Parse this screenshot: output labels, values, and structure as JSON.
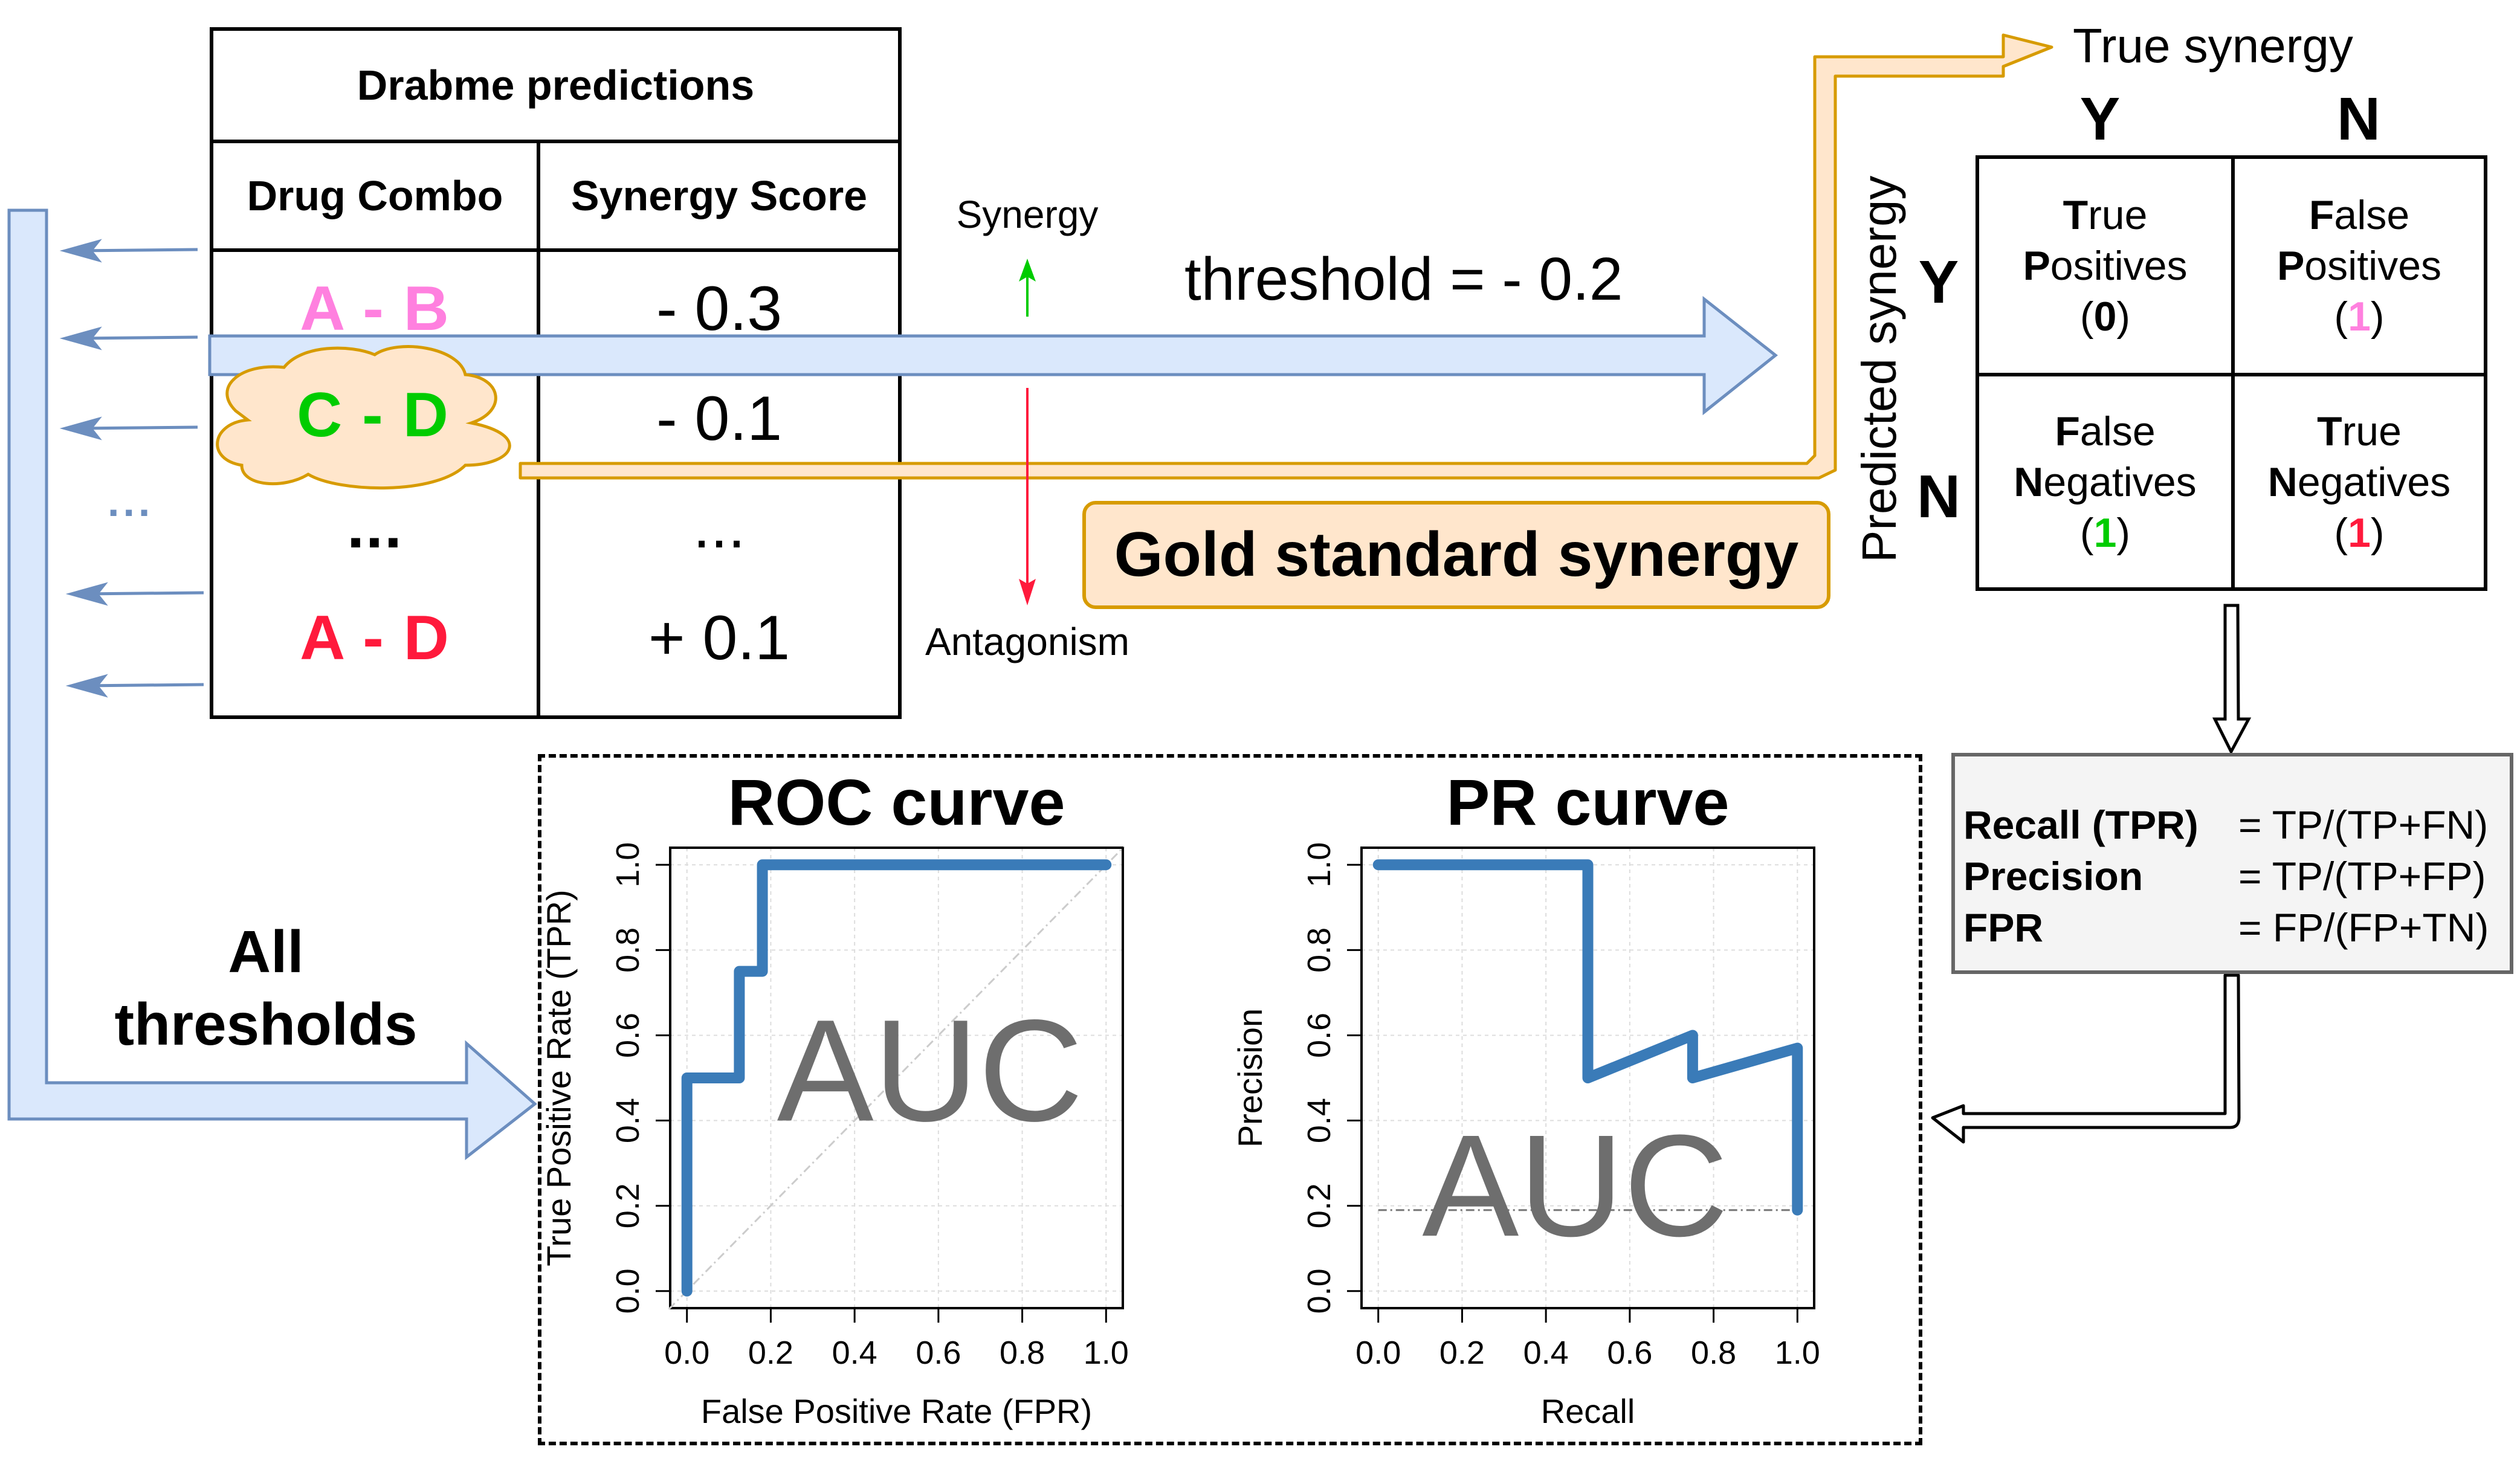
{
  "table": {
    "title": "Drabme predictions",
    "headers": [
      "Drug Combo",
      "Synergy Score"
    ],
    "rows": [
      {
        "combo": "A - B",
        "score": "- 0.3",
        "color": "#ff80df"
      },
      {
        "combo": "C - D",
        "score": "- 0.1",
        "color": "#00cc00"
      },
      {
        "combo": "...",
        "score": "...",
        "color": "#000000"
      },
      {
        "combo": "A - D",
        "score": "+ 0.1",
        "color": "#ff1a3c"
      }
    ],
    "left_ellipsis": "..."
  },
  "direction": {
    "up_label": "Synergy",
    "down_label": "Antagonism"
  },
  "threshold_label": "threshold = - 0.2",
  "gold_standard_label": "Gold standard synergy",
  "all_thresholds_label": [
    "All",
    "thresholds"
  ],
  "confusion_matrix": {
    "true_label": "True synergy",
    "predicted_label": "Predicted synergy",
    "col_labels": [
      "Y",
      "N"
    ],
    "row_labels": [
      "Y",
      "N"
    ],
    "cells": [
      {
        "bold1": "T",
        "rest1": "rue",
        "bold2": "P",
        "rest2": "ositives",
        "count": "0",
        "count_color": "#000000"
      },
      {
        "bold1": "F",
        "rest1": "alse",
        "bold2": "P",
        "rest2": "ositives",
        "count": "1",
        "count_color": "#ff80df"
      },
      {
        "bold1": "F",
        "rest1": "alse",
        "bold2": "N",
        "rest2": "egatives",
        "count": "1",
        "count_color": "#00cc00"
      },
      {
        "bold1": "T",
        "rest1": "rue",
        "bold2": "N",
        "rest2": "egatives",
        "count": "1",
        "count_color": "#ff1a3c"
      }
    ]
  },
  "formulas": [
    {
      "label": "Recall (TPR)",
      "expr": "= TP/(TP+FN)"
    },
    {
      "label": "Precision",
      "expr": "= TP/(TP+FP)"
    },
    {
      "label": "FPR",
      "expr": "= FP/(FP+TN)"
    }
  ],
  "colors": {
    "blue_arrow_fill": "#dae8fc",
    "blue_arrow_stroke": "#6c8ebf",
    "gold_fill": "#ffe6cc",
    "gold_stroke": "#d79b00",
    "curve": "#3a7bb8",
    "auc_text": "#6e6e6e"
  },
  "chart_data": [
    {
      "type": "line",
      "title": "ROC curve",
      "xlabel": "False Positive Rate (FPR)",
      "ylabel": "True Positive Rate (TPR)",
      "xlim": [
        0,
        1
      ],
      "ylim": [
        0,
        1
      ],
      "xticks": [
        "0.0",
        "0.2",
        "0.4",
        "0.6",
        "0.8",
        "1.0"
      ],
      "yticks": [
        "0.0",
        "0.2",
        "0.4",
        "0.6",
        "0.8",
        "1.0"
      ],
      "grid": true,
      "annotation": "AUC",
      "series": [
        {
          "name": "ROC",
          "x": [
            0,
            0,
            0.125,
            0.125,
            0.18,
            0.18,
            1.0
          ],
          "y": [
            0,
            0.5,
            0.5,
            0.75,
            0.75,
            1.0,
            1.0
          ]
        }
      ],
      "reference_line": {
        "x": [
          0,
          1
        ],
        "y": [
          0,
          1
        ],
        "style": "dashed"
      }
    },
    {
      "type": "line",
      "title": "PR curve",
      "xlabel": "Recall",
      "ylabel": "Precision",
      "xlim": [
        0,
        1
      ],
      "ylim": [
        0,
        1
      ],
      "xticks": [
        "0.0",
        "0.2",
        "0.4",
        "0.6",
        "0.8",
        "1.0"
      ],
      "yticks": [
        "0.0",
        "0.2",
        "0.4",
        "0.6",
        "0.8",
        "1.0"
      ],
      "grid": true,
      "annotation": "AUC",
      "series": [
        {
          "name": "PR",
          "x": [
            0,
            0.5,
            0.5,
            0.75,
            0.75,
            1.0,
            1.0
          ],
          "y": [
            1.0,
            1.0,
            0.5,
            0.6,
            0.5,
            0.57,
            0.19
          ]
        }
      ],
      "reference_line": {
        "x": [
          0,
          1
        ],
        "y": [
          0.19,
          0.19
        ],
        "style": "dashed"
      }
    }
  ]
}
